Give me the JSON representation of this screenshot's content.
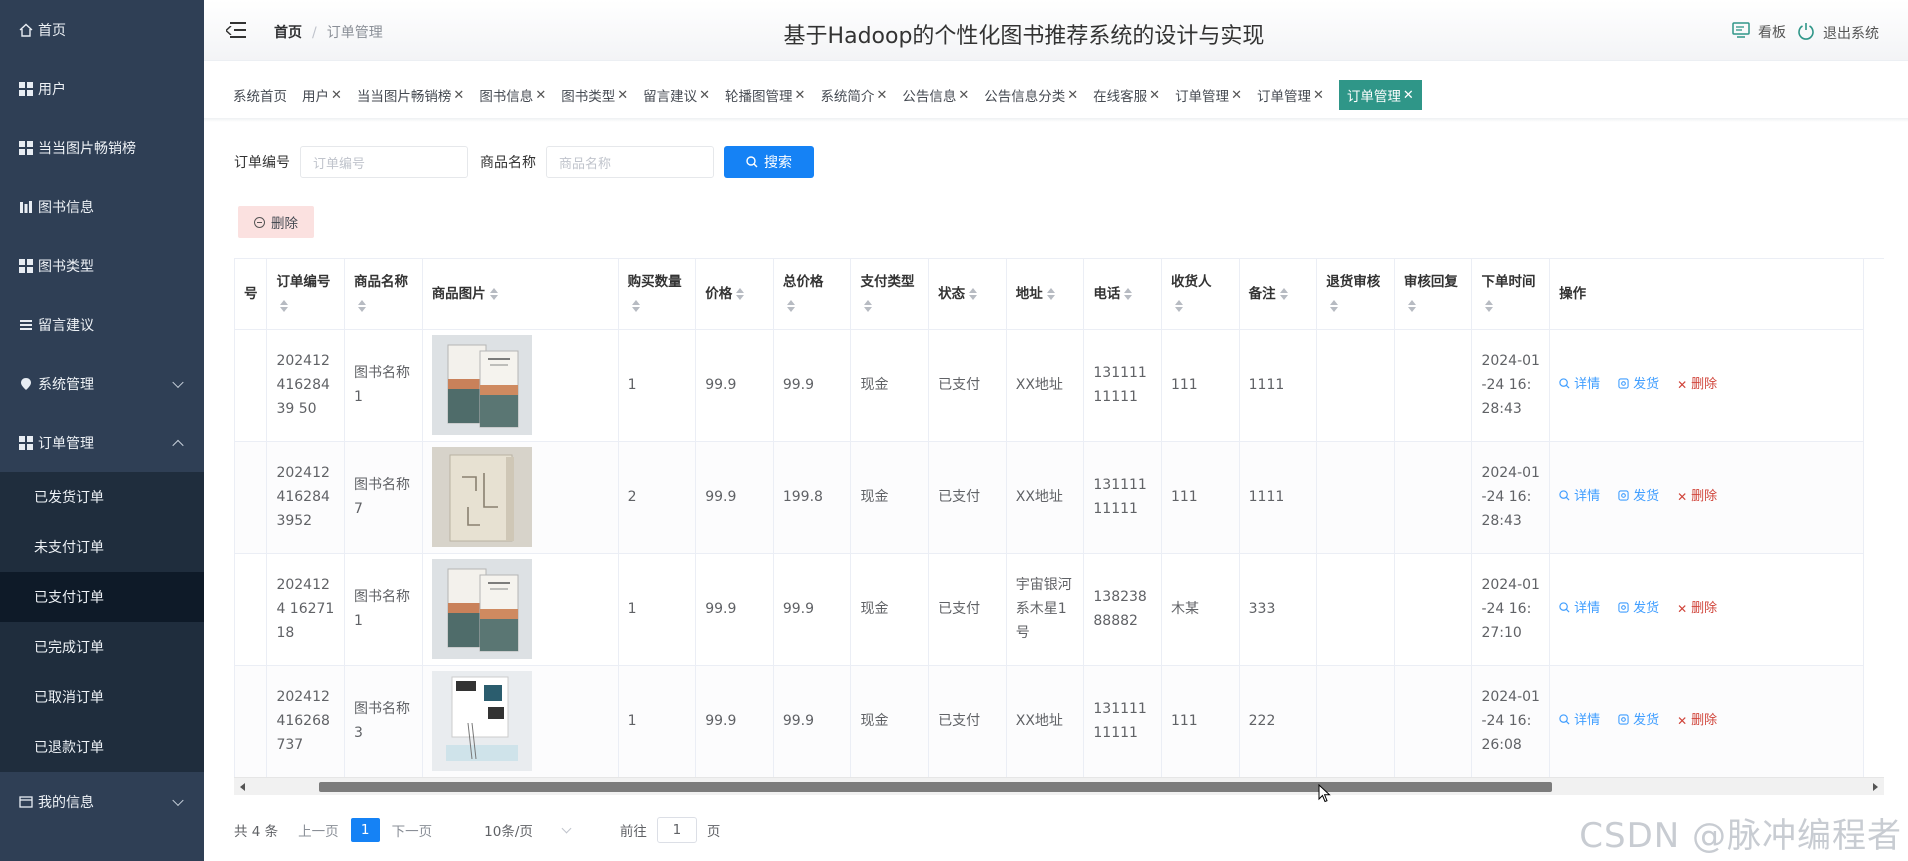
{
  "sidebar": {
    "items": [
      {
        "label": "首页",
        "icon": "home-icon"
      },
      {
        "label": "用户",
        "icon": "grid-icon"
      },
      {
        "label": "当当图片畅销榜",
        "icon": "grid-icon"
      },
      {
        "label": "图书信息",
        "icon": "bar-icon"
      },
      {
        "label": "图书类型",
        "icon": "grid-icon"
      },
      {
        "label": "留言建议",
        "icon": "list-icon"
      },
      {
        "label": "系统管理",
        "icon": "pin-icon"
      },
      {
        "label": "订单管理",
        "icon": "grid-icon"
      }
    ],
    "submenu": [
      {
        "label": "已发货订单"
      },
      {
        "label": "未支付订单"
      },
      {
        "label": "已支付订单"
      },
      {
        "label": "已完成订单"
      },
      {
        "label": "已取消订单"
      },
      {
        "label": "已退款订单"
      }
    ],
    "my_info": {
      "label": "我的信息",
      "icon": "card-icon"
    }
  },
  "header": {
    "breadcrumb_home": "首页",
    "breadcrumb_sep": "/",
    "breadcrumb_current": "订单管理",
    "title": "基于Hadoop的个性化图书推荐系统的设计与实现",
    "dashboard_label": "看板",
    "logout_label": "退出系统"
  },
  "tags": [
    {
      "label": "系统首页",
      "closable": false
    },
    {
      "label": "用户",
      "closable": true
    },
    {
      "label": "当当图片畅销榜",
      "closable": true
    },
    {
      "label": "图书信息",
      "closable": true
    },
    {
      "label": "图书类型",
      "closable": true
    },
    {
      "label": "留言建议",
      "closable": true
    },
    {
      "label": "轮播图管理",
      "closable": true
    },
    {
      "label": "系统简介",
      "closable": true
    },
    {
      "label": "公告信息",
      "closable": true
    },
    {
      "label": "公告信息分类",
      "closable": true
    },
    {
      "label": "在线客服",
      "closable": true
    },
    {
      "label": "订单管理",
      "closable": true
    },
    {
      "label": "订单管理",
      "closable": true
    },
    {
      "label": "订单管理",
      "closable": true,
      "active": true
    }
  ],
  "close_glyph": "✕",
  "search": {
    "order_label": "订单编号",
    "order_placeholder": "订单编号",
    "product_label": "商品名称",
    "product_placeholder": "商品名称",
    "button_label": "搜索"
  },
  "delete_button": "删除",
  "table": {
    "first_col_fragment": "号",
    "headers": [
      "订单编号",
      "商品名称",
      "商品图片",
      "购买数量",
      "价格",
      "总价格",
      "支付类型",
      "状态",
      "地址",
      "电话",
      "收货人",
      "备注",
      "退货审核",
      "审核回复",
      "下单时间",
      "操作"
    ],
    "rows": [
      {
        "order_no": "20241241628439 50",
        "product": "图书名称1",
        "cover": "book-cover-1",
        "qty": "1",
        "price": "99.9",
        "total": "99.9",
        "pay_type": "现金",
        "status": "已支付",
        "address": "XX地址",
        "phone": "13111111111",
        "receiver": "111",
        "remark": "1111",
        "return_review": "",
        "review_reply": "",
        "time": "2024-01-24 16:28:43"
      },
      {
        "order_no": "2024124162843952",
        "product": "图书名称7",
        "cover": "book-cover-7",
        "qty": "2",
        "price": "99.9",
        "total": "199.8",
        "pay_type": "现金",
        "status": "已支付",
        "address": "XX地址",
        "phone": "13111111111",
        "receiver": "111",
        "remark": "1111",
        "return_review": "",
        "review_reply": "",
        "time": "2024-01-24 16:28:43"
      },
      {
        "order_no": "2024124 1627118",
        "product": "图书名称1",
        "cover": "book-cover-1",
        "qty": "1",
        "price": "99.9",
        "total": "99.9",
        "pay_type": "现金",
        "status": "已支付",
        "address": "宇宙银河系木星1号",
        "phone": "13823888882",
        "receiver": "木某",
        "remark": "333",
        "return_review": "",
        "review_reply": "",
        "time": "2024-01-24 16:27:10"
      },
      {
        "order_no": "202412416268737",
        "product": "图书名称3",
        "cover": "book-cover-3",
        "qty": "1",
        "price": "99.9",
        "total": "99.9",
        "pay_type": "现金",
        "status": "已支付",
        "address": "XX地址",
        "phone": "13111111111",
        "receiver": "111",
        "remark": "222",
        "return_review": "",
        "review_reply": "",
        "time": "2024-01-24 16:26:08"
      }
    ],
    "ops": {
      "detail": "详情",
      "ship": "发货",
      "delete": "删除"
    }
  },
  "pager": {
    "total": "共 4 条",
    "prev": "上一页",
    "current": "1",
    "next": "下一页",
    "size": "10条/页",
    "goto_prefix": "前往",
    "goto_value": "1",
    "goto_suffix": "页"
  },
  "watermark": "CSDN @脉冲编程者",
  "colors": {
    "sidebar": "#2f3f55",
    "accent": "#1582f5",
    "active_tag": "#2f9688",
    "danger": "#d0443a"
  }
}
